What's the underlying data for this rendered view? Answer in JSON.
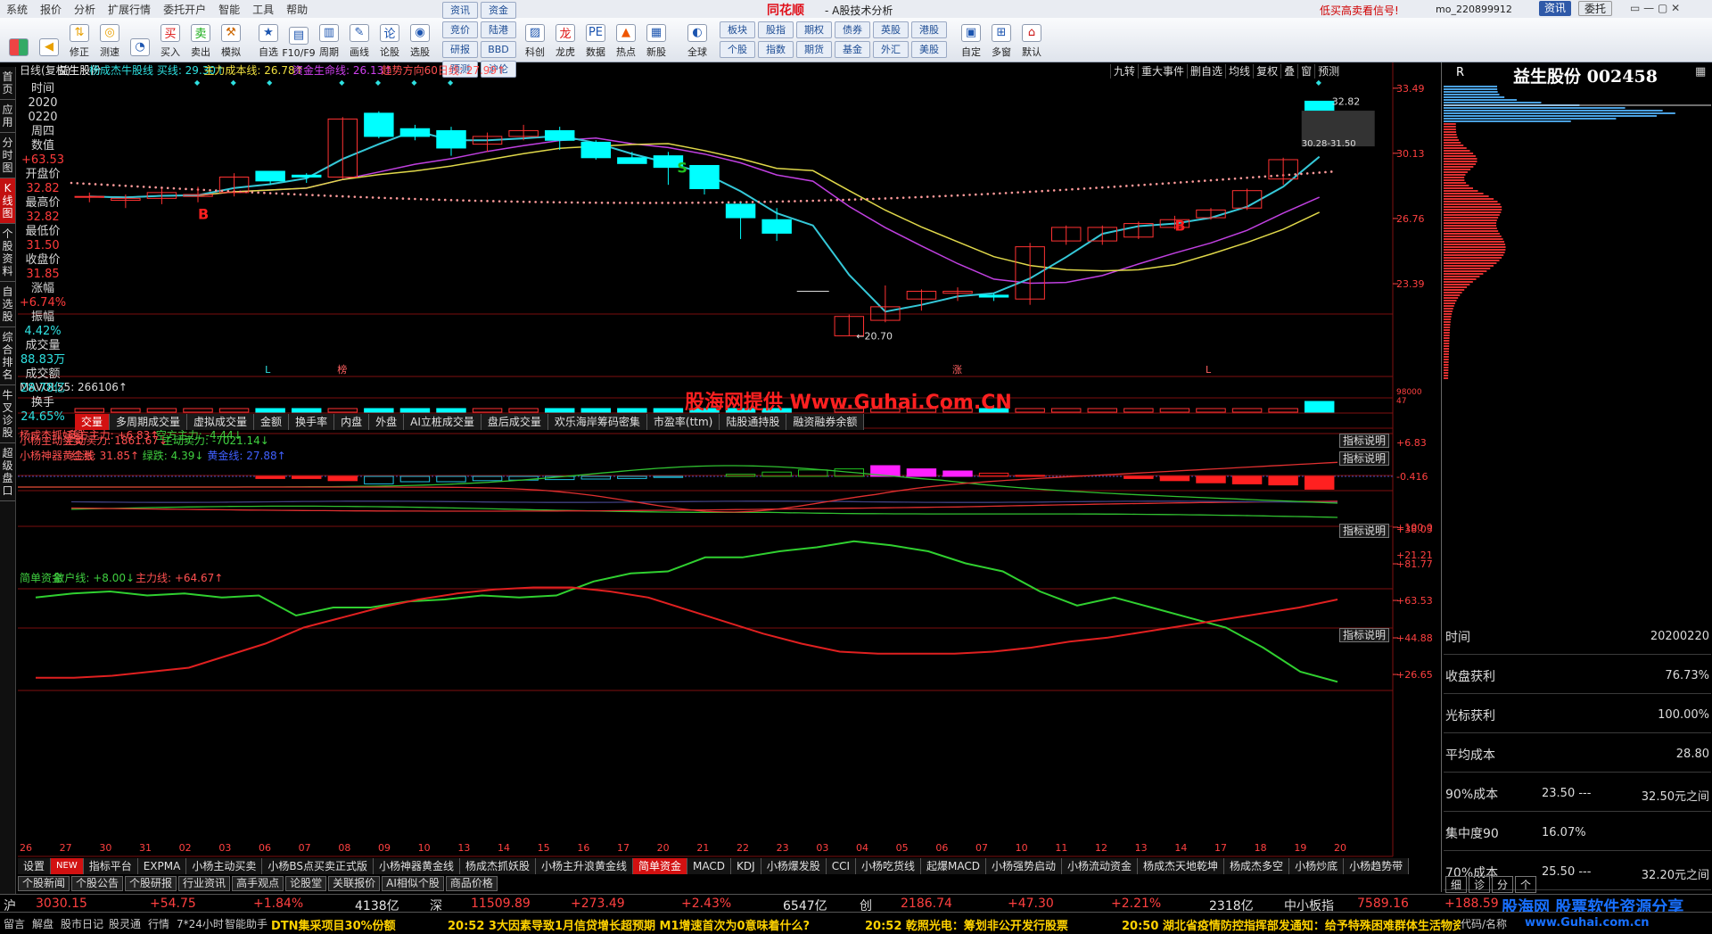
{
  "menu": {
    "items": [
      "系统",
      "报价",
      "分析",
      "扩展行情",
      "委托开户",
      "智能",
      "工具",
      "帮助"
    ],
    "brand": "同花顺",
    "title": "- A股技术分析",
    "promo": "低买高卖看信号!",
    "account": "mo_220899912",
    "btn_news": "资讯",
    "btn_trade": "委托"
  },
  "toolbar": {
    "buttons": [
      "修正",
      "测速",
      "买入",
      "卖出",
      "模拟",
      "自选",
      "F10/F9",
      "周期",
      "画线",
      "论股",
      "选股"
    ],
    "grid1": [
      "资讯",
      "资金",
      "竞价",
      "陆港",
      "研报",
      "BBD",
      "预测",
      "沪伦"
    ],
    "buttons2": [
      "科创",
      "龙虎",
      "数据",
      "热点",
      "新股",
      "全球"
    ],
    "grid2": [
      "板块",
      "股指",
      "期权",
      "债券",
      "英股",
      "港股",
      "个股",
      "指数",
      "期货",
      "基金",
      "外汇",
      "美股"
    ],
    "buttons3": [
      "自定",
      "多窗",
      "默认"
    ]
  },
  "left_tabs": [
    {
      "label": "首页",
      "active": false
    },
    {
      "label": "应用",
      "active": false
    },
    {
      "label": "分时图",
      "active": false
    },
    {
      "label": "K线图",
      "active": true
    },
    {
      "label": "个股资料",
      "active": false
    },
    {
      "label": "自选股",
      "active": false
    },
    {
      "label": "综合排名",
      "active": false
    },
    {
      "label": "牛叉诊股",
      "active": false
    },
    {
      "label": "超级盘口",
      "active": false
    }
  ],
  "chart_header": {
    "period": "日线(复权)",
    "stock": "益生股份",
    "ind1": "杨成杰牛股线 买线: 29.30↑",
    "ind2": "主力成本线: 26.78↑",
    "ind3": "资金生命线: 26.13↑",
    "ind4": "趋势方向60日线: 27.99↑"
  },
  "top_right_tabs": [
    "九转",
    "重大事件",
    "删自选",
    "均线",
    "复权",
    "叠",
    "窗",
    "预测"
  ],
  "info": {
    "time_label": "时间",
    "date1": "2020",
    "date2": "0220",
    "weekday": "周四",
    "value_label": "数值",
    "value": "+63.53",
    "open_label": "开盘价",
    "open": "32.82",
    "high_label": "最高价",
    "high": "32.82",
    "low_label": "最低价",
    "low": "31.50",
    "close_label": "收盘价",
    "close": "31.85",
    "chg_label": "涨幅",
    "chg": "+6.74%",
    "amp_label": "振幅",
    "amp": "4.42%",
    "vol_label": "成交量",
    "vol": "88.83万",
    "amt_label": "成交额",
    "amt": "28.78亿",
    "turn_label": "换手",
    "turn": "24.65%"
  },
  "price_axis": [
    "33.49",
    "30.13",
    "26.76",
    "23.39"
  ],
  "annotations": {
    "top_price": "32.82",
    "range_box": "30.28-31.50",
    "low_price": "←20.70",
    "b_label": "B",
    "s_label": "S",
    "l_label": "L",
    "bang_label": "榜",
    "zhang_label": "涨"
  },
  "volume": {
    "label": "MAVOL55: 266106↑",
    "axis1": "98000",
    "axis2": "47"
  },
  "volume_tabs": [
    {
      "label": "交量",
      "active": true
    },
    {
      "label": "多周期成交量",
      "active": false
    },
    {
      "label": "虚拟成交量",
      "active": false
    },
    {
      "label": "金额",
      "active": false
    },
    {
      "label": "换手率",
      "active": false
    },
    {
      "label": "内盘",
      "active": false
    },
    {
      "label": "外盘",
      "active": false
    },
    {
      "label": "AI立桩成交量",
      "active": false
    },
    {
      "label": "盘后成交量",
      "active": false
    },
    {
      "label": "欢乐海岸筹码密集",
      "active": false
    },
    {
      "label": "市盈率(ttm)",
      "active": false
    },
    {
      "label": "陆股通持股",
      "active": false
    },
    {
      "label": "融资融券余额",
      "active": false
    }
  ],
  "indicators": {
    "p1": {
      "title": "小杨主动买卖",
      "buy": "主动买力: 1861.67↓",
      "sell": "主动卖力: -7021.14↓",
      "btn": "指标说明"
    },
    "p2": {
      "title": "小杨神器黄金线",
      "red": "红涨: 31.85↑",
      "green": "绿跌: 4.39↓",
      "blue": "黄金线: 27.88↑",
      "btn": "指标说明",
      "axis": [
        "+38.03",
        "+21.21"
      ]
    },
    "p3": {
      "title": "杨成杰抓妖股",
      "bull": "多方主力: +6.83↑",
      "bear": "空方主力: -4.44↓",
      "btn": "指标说明",
      "axis": [
        "+6.83",
        "-0.416"
      ]
    },
    "p4": {
      "title": "简单资金",
      "retail": "散户线: +8.00↓",
      "main": "主力线: +64.67↑",
      "btn": "指标说明",
      "axis": [
        "+100.0",
        "+81.77",
        "+63.53",
        "+44.88",
        "+26.65"
      ]
    }
  },
  "watermark": "股海网提供 Www.Guhai.Com.CN",
  "dates": [
    "26",
    "27",
    "30",
    "31",
    "02",
    "03",
    "06",
    "07",
    "08",
    "09",
    "10",
    "13",
    "14",
    "15",
    "16",
    "17",
    "20",
    "21",
    "22",
    "23",
    "03",
    "04",
    "05",
    "06",
    "07",
    "10",
    "11",
    "12",
    "13",
    "14",
    "17",
    "18",
    "19",
    "20"
  ],
  "bottom_tabs": [
    {
      "label": "设置",
      "active": false
    },
    {
      "label": "NEW",
      "active": false
    },
    {
      "label": "指标平台",
      "active": false
    },
    {
      "label": "EXPMA",
      "active": false
    },
    {
      "label": "小杨主动买卖",
      "active": false
    },
    {
      "label": "小杨BS点买卖正式版",
      "active": false
    },
    {
      "label": "小杨神器黄金线",
      "active": false
    },
    {
      "label": "杨成杰抓妖股",
      "active": false
    },
    {
      "label": "小杨主升浪黄金线",
      "active": false
    },
    {
      "label": "简单资金",
      "active": true
    },
    {
      "label": "MACD",
      "active": false
    },
    {
      "label": "KDJ",
      "active": false
    },
    {
      "label": "小杨爆发股",
      "active": false
    },
    {
      "label": "CCI",
      "active": false
    },
    {
      "label": "小杨吃货线",
      "active": false
    },
    {
      "label": "起爆MACD",
      "active": false
    },
    {
      "label": "小杨强势启动",
      "active": false
    },
    {
      "label": "小杨流动资金",
      "active": false
    },
    {
      "label": "杨成杰天地乾坤",
      "active": false
    },
    {
      "label": "杨成杰多空",
      "active": false
    },
    {
      "label": "小杨炒底",
      "active": false
    },
    {
      "label": "小杨趋势带",
      "active": false
    }
  ],
  "news_tabs": [
    "个股新闻",
    "个股公告",
    "个股研报",
    "行业资讯",
    "高手观点",
    "论股堂",
    "关联报价",
    "AI相似个股",
    "商品价格"
  ],
  "right_panel": {
    "code": "R",
    "title": "益生股份 002458",
    "tabs": [
      "细",
      "诊",
      "分",
      "个"
    ],
    "stats": [
      {
        "k": "时间",
        "v1": "",
        "v2": "20200220"
      },
      {
        "k": "收盘获利",
        "v1": "",
        "v2": "76.73%"
      },
      {
        "k": "光标获利",
        "v1": "",
        "v2": "100.00%"
      },
      {
        "k": "平均成本",
        "v1": "",
        "v2": "28.80"
      },
      {
        "k": "90%成本",
        "v1": "23.50 ---",
        "v2": "32.50元之间"
      },
      {
        "k": "集中度90",
        "v1": "16.07%",
        "v2": ""
      },
      {
        "k": "70%成本",
        "v1": "25.50 ---",
        "v2": "32.20元之间"
      },
      {
        "k": "集中度70",
        "v1": "11.61%",
        "v2": ""
      }
    ]
  },
  "ticker": {
    "sh_label": "沪",
    "sh": "3030.15",
    "sh_chg": "+54.75",
    "sh_pct": "+1.84%",
    "sh_amt": "4138亿",
    "sz_label": "深",
    "sz": "11509.89",
    "sz_chg": "+273.49",
    "sz_pct": "+2.43%",
    "sz_amt": "6547亿",
    "cy_label": "创",
    "cy": "2186.74",
    "cy_chg": "+47.30",
    "cy_pct": "+2.21%",
    "cy_amt": "2318亿",
    "zx_label": "中小板指",
    "zx": "7589.16",
    "zx_chg": "+188.59"
  },
  "newsbar": {
    "tabs": [
      "留言",
      "解盘",
      "股市日记",
      "股灵通",
      "行情",
      "7*24小时",
      "智能助手"
    ],
    "n0": "DTN集采项目30%份额",
    "n1": "20:52 3大因素导致1月信贷增长超预期 M1增速首次为0意味着什么?",
    "n2": "20:52 乾照光电：筹划非公开发行股票",
    "n3": "20:50 湖北省疫情防控指挥部发通知：给予特殊困难群体生活物资",
    "site": "股海网 股票软件资源分享",
    "url": "www.Guhai.com.cn",
    "code": "代码/名称"
  },
  "colors": {
    "up": "#ff3232",
    "down": "#00ffff",
    "ma_cyan": "#35c8d8",
    "ma_yellow": "#e0d84a",
    "ma_purple": "#c040e0",
    "dots": "#ff9a9a"
  },
  "chart_data": {
    "type": "candlestick",
    "ylim": [
      18.6,
      33.9
    ],
    "candles": [
      {
        "o": 27.9,
        "h": 28.1,
        "l": 27.6,
        "c": 27.9
      },
      {
        "o": 27.7,
        "h": 28.0,
        "l": 27.3,
        "c": 27.8
      },
      {
        "o": 27.8,
        "h": 28.3,
        "l": 27.5,
        "c": 28.1
      },
      {
        "o": 27.9,
        "h": 28.4,
        "l": 27.6,
        "c": 28.0
      },
      {
        "o": 28.1,
        "h": 29.1,
        "l": 27.9,
        "c": 28.9
      },
      {
        "o": 29.2,
        "h": 29.2,
        "l": 28.5,
        "c": 28.7
      },
      {
        "o": 29.0,
        "h": 29.1,
        "l": 28.6,
        "c": 28.9
      },
      {
        "o": 28.9,
        "h": 32.0,
        "l": 28.8,
        "c": 31.9
      },
      {
        "o": 32.2,
        "h": 32.3,
        "l": 30.9,
        "c": 31.0
      },
      {
        "o": 31.4,
        "h": 31.6,
        "l": 30.8,
        "c": 31.0
      },
      {
        "o": 31.3,
        "h": 31.5,
        "l": 30.0,
        "c": 30.4
      },
      {
        "o": 30.6,
        "h": 31.2,
        "l": 30.2,
        "c": 31.0
      },
      {
        "o": 31.0,
        "h": 31.6,
        "l": 30.8,
        "c": 31.3
      },
      {
        "o": 31.3,
        "h": 31.5,
        "l": 30.3,
        "c": 30.8
      },
      {
        "o": 30.7,
        "h": 30.8,
        "l": 29.8,
        "c": 29.9
      },
      {
        "o": 29.9,
        "h": 30.2,
        "l": 29.6,
        "c": 29.6
      },
      {
        "o": 30.0,
        "h": 30.2,
        "l": 28.5,
        "c": 29.4
      },
      {
        "o": 29.5,
        "h": 29.5,
        "l": 28.0,
        "c": 28.3
      },
      {
        "o": 27.5,
        "h": 27.6,
        "l": 25.7,
        "c": 26.8
      },
      {
        "o": 26.7,
        "h": 27.3,
        "l": 25.6,
        "c": 26.0
      },
      {
        "o": null
      },
      {
        "o": 20.7,
        "h": 21.8,
        "l": 20.7,
        "c": 21.7
      },
      {
        "o": 21.5,
        "h": 23.3,
        "l": 21.4,
        "c": 22.2
      },
      {
        "o": 22.6,
        "h": 23.1,
        "l": 22.0,
        "c": 23.0
      },
      {
        "o": 22.9,
        "h": 23.2,
        "l": 22.5,
        "c": 23.0
      },
      {
        "o": 22.8,
        "h": 22.9,
        "l": 22.5,
        "c": 22.7
      },
      {
        "o": 22.6,
        "h": 25.5,
        "l": 22.3,
        "c": 25.3
      },
      {
        "o": 25.6,
        "h": 26.4,
        "l": 25.4,
        "c": 26.3
      },
      {
        "o": 25.6,
        "h": 26.4,
        "l": 25.4,
        "c": 26.3
      },
      {
        "o": 25.8,
        "h": 26.6,
        "l": 25.7,
        "c": 26.5
      },
      {
        "o": 26.3,
        "h": 26.9,
        "l": 26.2,
        "c": 26.7
      },
      {
        "o": 26.8,
        "h": 27.3,
        "l": 26.7,
        "c": 27.2
      },
      {
        "o": 27.3,
        "h": 28.3,
        "l": 27.2,
        "c": 28.2
      },
      {
        "o": 28.8,
        "h": 29.9,
        "l": 28.5,
        "c": 29.8
      },
      {
        "o": 32.82,
        "h": 32.82,
        "l": 31.5,
        "c": 31.85
      }
    ]
  }
}
